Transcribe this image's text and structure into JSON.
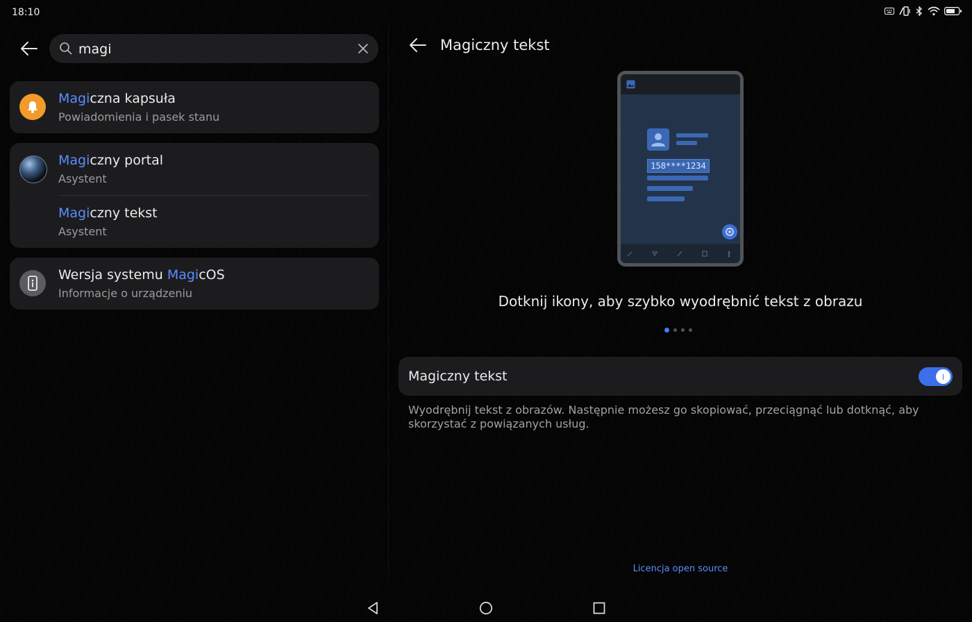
{
  "status_bar": {
    "time": "18:10"
  },
  "search": {
    "value": "magi",
    "placeholder": ""
  },
  "results": [
    {
      "match": "Magi",
      "rest": "czna kapsuła",
      "subtitle": "Powiadomienia i pasek stanu",
      "icon": "bell-icon",
      "icon_color": "#f29b2b"
    },
    {
      "match": "Magi",
      "rest": "czny portal",
      "subtitle": "Asystent",
      "icon": "sphere-icon"
    },
    {
      "match": "Magi",
      "rest": "czny tekst",
      "subtitle": "Asystent"
    },
    {
      "prefix": "Wersja systemu ",
      "match": "Magi",
      "rest": "cOS",
      "subtitle": "Informacje o urządzeniu",
      "icon": "info-icon"
    }
  ],
  "detail": {
    "title": "Magiczny tekst",
    "illustration_number": "158****1234",
    "caption": "Dotknij ikony, aby szybko wyodrębnić tekst z obrazu",
    "pager": {
      "count": 4,
      "active": 0
    },
    "toggle_label": "Magiczny tekst",
    "toggle_on": true,
    "description": "Wyodrębnij tekst z obrazów. Następnie możesz go skopiować, przeciągnąć lub dotknąć, aby skorzystać z powiązanych usług.",
    "license": "Licencja open source"
  },
  "colors": {
    "accent": "#5b8dff",
    "toggle": "#3d6fe8",
    "card": "#1c1c1e"
  }
}
